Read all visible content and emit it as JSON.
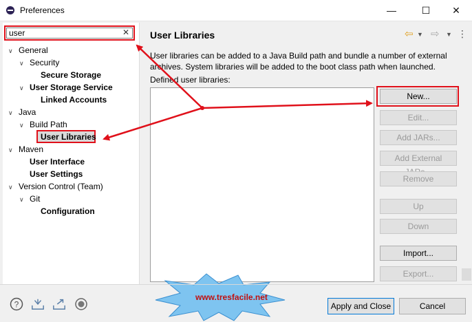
{
  "window": {
    "title": "Preferences",
    "minimize": "—",
    "maximize": "☐",
    "close": "✕"
  },
  "filter": {
    "value": "user",
    "clear": "✕"
  },
  "tree": {
    "general": "General",
    "security": "Security",
    "secure_storage": "Secure Storage",
    "user_storage_service": "User Storage Service",
    "linked_accounts": "Linked Accounts",
    "java": "Java",
    "build_path": "Build Path",
    "user_libraries": "User Libraries",
    "maven": "Maven",
    "user_interface": "User Interface",
    "user_settings": "User Settings",
    "version_control": "Version Control (Team)",
    "git": "Git",
    "configuration": "Configuration"
  },
  "page": {
    "title": "User Libraries",
    "description": "User libraries can be added to a Java Build path and bundle a number of external archives. System libraries will be added to the boot class path when launched.",
    "defined_label": "Defined user libraries:"
  },
  "buttons": {
    "new": "New...",
    "edit": "Edit...",
    "add_jars": "Add JARs...",
    "add_external_jars": "Add External JARs...",
    "remove": "Remove",
    "up": "Up",
    "down": "Down",
    "import": "Import...",
    "export": "Export..."
  },
  "footer": {
    "apply_close": "Apply and Close",
    "cancel": "Cancel"
  },
  "watermark": "www.tresfacile.net",
  "colors": {
    "highlight": "#e0101a",
    "selection": "#d9d9d9",
    "default_button_border": "#0078d7"
  }
}
